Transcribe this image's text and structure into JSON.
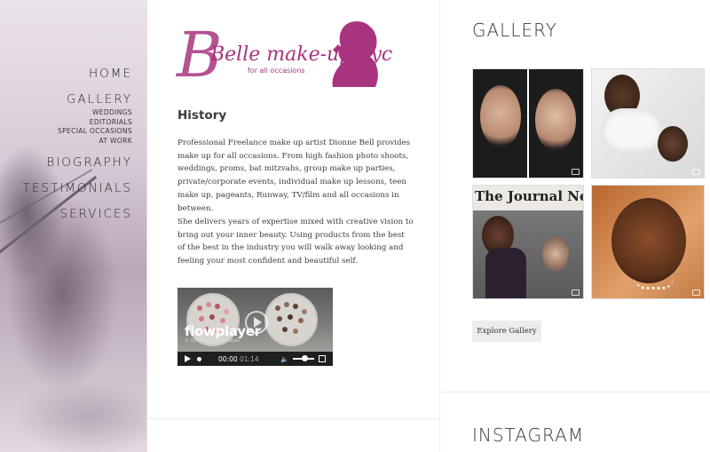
{
  "brand": {
    "logo_main": "Belle make-up nyc",
    "logo_sub": "for all occasions",
    "logo_color": "#a8347f"
  },
  "nav": {
    "home": "HOME",
    "gallery": "GALLERY",
    "gallery_sub": [
      "WEDDINGS",
      "EDITORIALS",
      "SPECIAL OCCASIONS",
      "AT WORK"
    ],
    "biography": "BIOGRAPHY",
    "testimonials": "TESTIMONIALS",
    "services": "SERVICES"
  },
  "history": {
    "title": "History",
    "para1": "Professional Freelance make up artist Dionne Bell provides make up for all occasions. From high fashion photo shoots, weddings, proms, bat mitzvahs, group make up parties, private/corporate events, individual make up lessons, teen make up, pageants, Runway, TV/film and all occasions in between.",
    "para2": "She delivers years of expertise mixed with creative vision to bring out your inner beauty. Using products from the best of the best in the industry you will walk away looking and feeling your most confident and beautiful self."
  },
  "player": {
    "brand": "flowplayer",
    "copyright": "© 2008-2012 Flowplayer",
    "time_current": "00:00",
    "time_total": "01:14",
    "icons": [
      "play-icon",
      "volume-icon",
      "fullscreen-icon"
    ]
  },
  "gallery": {
    "title": "GALLERY",
    "thumb_c_text": "The Journal News",
    "button": "Explore Gallery"
  },
  "instagram": {
    "title": "INSTAGRAM"
  }
}
